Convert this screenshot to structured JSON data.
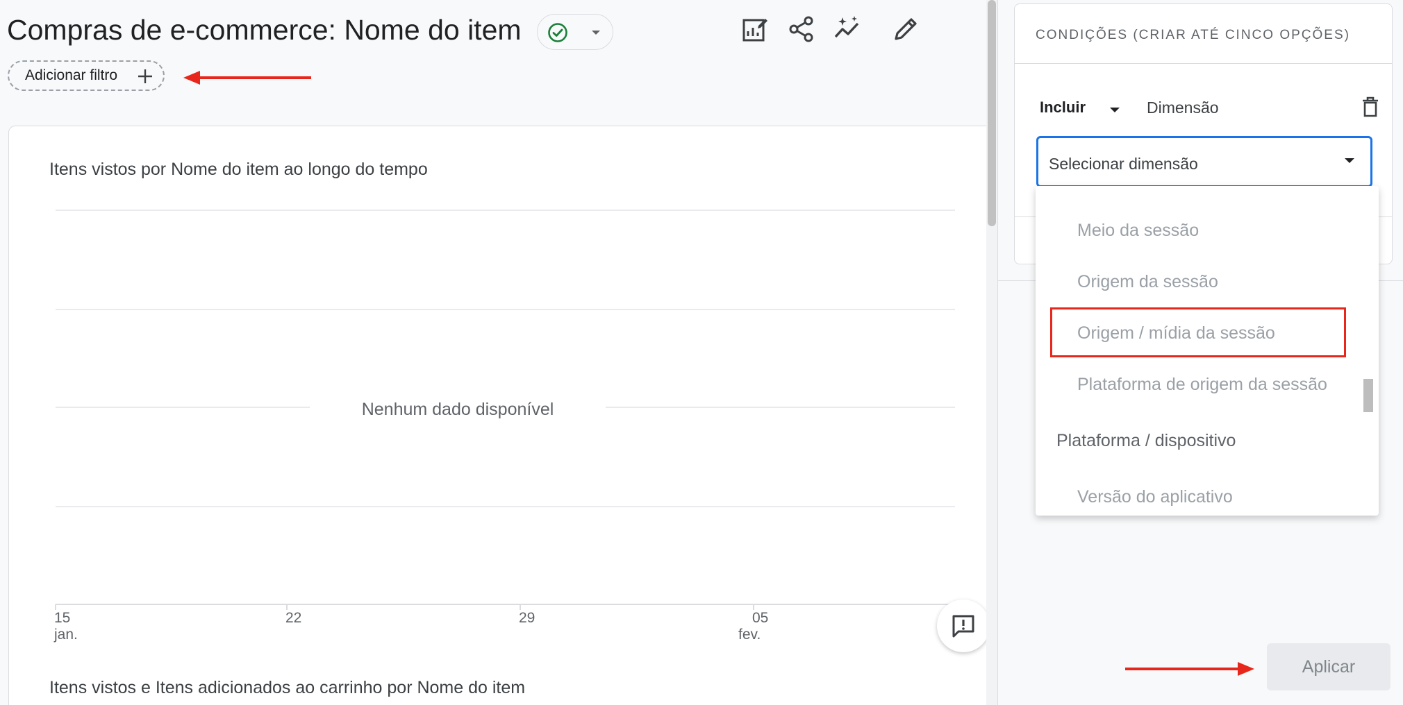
{
  "header": {
    "title": "Compras de e-commerce: Nome do item",
    "status_icon": "check-circle-icon",
    "toolbar_icons": [
      "customize-report-icon",
      "share-icon",
      "insights-icon",
      "edit-icon"
    ]
  },
  "filter": {
    "label": "Adicionar filtro"
  },
  "chart": {
    "title": "Itens vistos por Nome do item ao longo do tempo",
    "empty_message": "Nenhum dado disponível",
    "x_ticks": [
      {
        "day": "15",
        "month": "jan."
      },
      {
        "day": "22",
        "month": ""
      },
      {
        "day": "29",
        "month": ""
      },
      {
        "day": "05",
        "month": "fev."
      }
    ],
    "second_title": "Itens vistos e Itens adicionados ao carrinho por Nome do item"
  },
  "chart_data": {
    "type": "line",
    "title": "Itens vistos por Nome do item ao longo do tempo",
    "categories": [
      "15 jan.",
      "22",
      "29",
      "05 fev."
    ],
    "series": [],
    "annotation": "Nenhum dado disponível",
    "grid": true
  },
  "panel": {
    "conditions_header": "CONDIÇÕES (CRIAR ATÉ CINCO OPÇÕES)",
    "include_label": "Incluir",
    "dimension_label": "Dimensão",
    "select_placeholder": "Selecionar dimensão",
    "dropdown_items": [
      {
        "label": "Meio da sessão",
        "type": "item"
      },
      {
        "label": "Origem da sessão",
        "type": "item"
      },
      {
        "label": "Origem / mídia da sessão",
        "type": "item",
        "highlighted": true
      },
      {
        "label": "Plataforma de origem da sessão",
        "type": "item"
      },
      {
        "label": "Plataforma / dispositivo",
        "type": "group"
      },
      {
        "label": "Versão do aplicativo",
        "type": "item"
      }
    ],
    "apply_label": "Aplicar"
  },
  "colors": {
    "accent": "#1a73e8",
    "annotation_red": "#e8271c",
    "success": "#188038"
  }
}
